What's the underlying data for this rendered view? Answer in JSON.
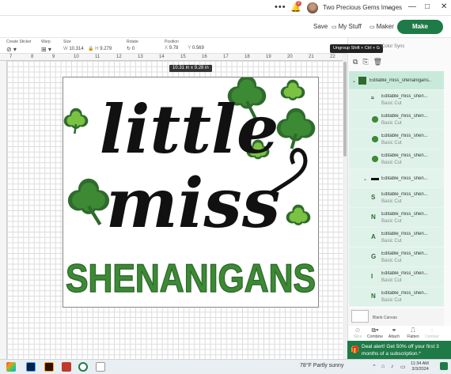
{
  "topbar": {
    "dots": "•••",
    "user_name": "Two Precious Gems Images",
    "notification_count": "2",
    "minimize": "—",
    "restore": "□",
    "close": "✕"
  },
  "actions": {
    "save": "Save",
    "my_stuff": "My Stuff",
    "maker": "Maker",
    "make": "Make"
  },
  "toolbar": {
    "create_sticker": "Create Sticker",
    "warp": "Warp",
    "size": "Size",
    "w_label": "W",
    "w_value": "10.314",
    "h_label": "H",
    "h_value": "9.279",
    "rotate": "Rotate",
    "rotate_value": "0",
    "position": "Position",
    "x_label": "X",
    "x_value": "9.78",
    "y_label": "Y",
    "y_value": "0.569"
  },
  "ruler": {
    "ticks": [
      "7",
      "8",
      "9",
      "10",
      "11",
      "12",
      "13",
      "14",
      "15",
      "16",
      "17",
      "18",
      "19",
      "20",
      "21",
      "22"
    ]
  },
  "canvas": {
    "dimension_tip": "10.31  in x 9.28  in"
  },
  "design": {
    "line1": "little",
    "line2": "miss",
    "line3": "SHENANIGANS",
    "colors": {
      "black": "#111111",
      "dark_green": "#2f6b2c",
      "light_green": "#7cc242",
      "mid_green": "#3d8a35"
    }
  },
  "panel": {
    "tooltip": "Ungroup Shift + Ctrl + G",
    "color_sync": "Color Sync",
    "layers": [
      {
        "name": "Editable_miss_shenanigans...",
        "op": "",
        "kind": "group"
      },
      {
        "name": "Editable_miss_shen...",
        "op": "Basic Cut",
        "kind": "item",
        "thumb": "black"
      },
      {
        "name": "Editable_miss_shen...",
        "op": "Basic Cut",
        "kind": "item",
        "thumb": "green"
      },
      {
        "name": "Editable_miss_shen...",
        "op": "Basic Cut",
        "kind": "item",
        "thumb": "green"
      },
      {
        "name": "Editable_miss_shen...",
        "op": "Basic Cut",
        "kind": "item",
        "thumb": "green"
      },
      {
        "name": "Editable_miss_shen...",
        "op": "",
        "kind": "subgroup"
      },
      {
        "name": "Editable_miss_shen...",
        "op": "Basic Cut",
        "kind": "item",
        "thumb": "S"
      },
      {
        "name": "Editable_miss_shen...",
        "op": "Basic Cut",
        "kind": "item",
        "thumb": "N"
      },
      {
        "name": "Editable_miss_shen...",
        "op": "Basic Cut",
        "kind": "item",
        "thumb": "A"
      },
      {
        "name": "Editable_miss_shen...",
        "op": "Basic Cut",
        "kind": "item",
        "thumb": "G"
      },
      {
        "name": "Editable_miss_shen...",
        "op": "Basic Cut",
        "kind": "item",
        "thumb": "I"
      },
      {
        "name": "Editable_miss_shen...",
        "op": "Basic Cut",
        "kind": "item",
        "thumb": "N"
      }
    ],
    "blank_canvas": "Blank Canvas",
    "tools": [
      "Slice",
      "Combine",
      "Attach",
      "Flatten",
      "Contour"
    ],
    "deal": "Deal alert! Get 50% off your first 3 months of a subscription.*"
  },
  "taskbar": {
    "weather": "78°F  Partly sunny",
    "time": "11:34 AM",
    "date": "3/3/2024"
  }
}
